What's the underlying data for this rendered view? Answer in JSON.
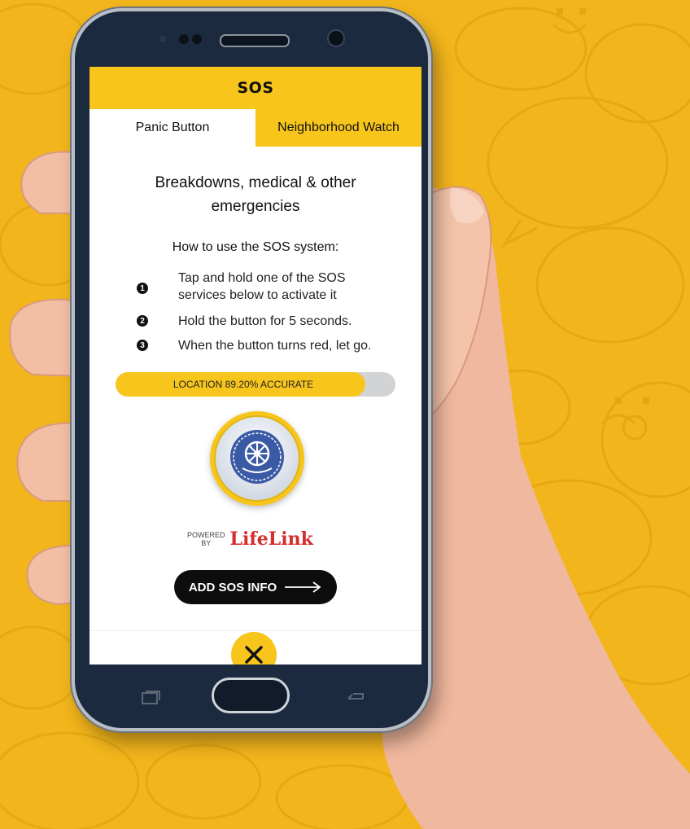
{
  "app": {
    "title": "SOS"
  },
  "tabs": [
    {
      "label": "Panic Button",
      "active": true
    },
    {
      "label": "Neighborhood Watch",
      "active": false
    }
  ],
  "content": {
    "heading_line1": "Breakdowns, medical & other",
    "heading_line2": "emergencies",
    "howto_title": "How to use the SOS system:",
    "steps": [
      {
        "number": "1",
        "text_line1": "Tap and hold one of the SOS",
        "text_line2": "services below to activate it"
      },
      {
        "number": "2",
        "text_line1": "Hold the button for 5 seconds."
      },
      {
        "number": "3",
        "text_line1": "When the button turns red, let go."
      }
    ]
  },
  "location": {
    "label": "LOCATION 89.20% ACCURATE",
    "accuracy_percent": 89.2
  },
  "sos_button": {
    "icon": "wheel-laurel-emblem-icon"
  },
  "powered_by": {
    "prefix_line1": "POWERED",
    "prefix_line2": "BY",
    "brand": "LifeLink"
  },
  "actions": {
    "add_info_label": "ADD SOS INFO",
    "close_icon": "close-icon"
  },
  "colors": {
    "accent_yellow": "#f7c51b",
    "background_yellow": "#f2b51c",
    "brand_red": "#d42f2f",
    "button_black": "#0d0d0d",
    "track_gray": "#d2d3d4"
  }
}
